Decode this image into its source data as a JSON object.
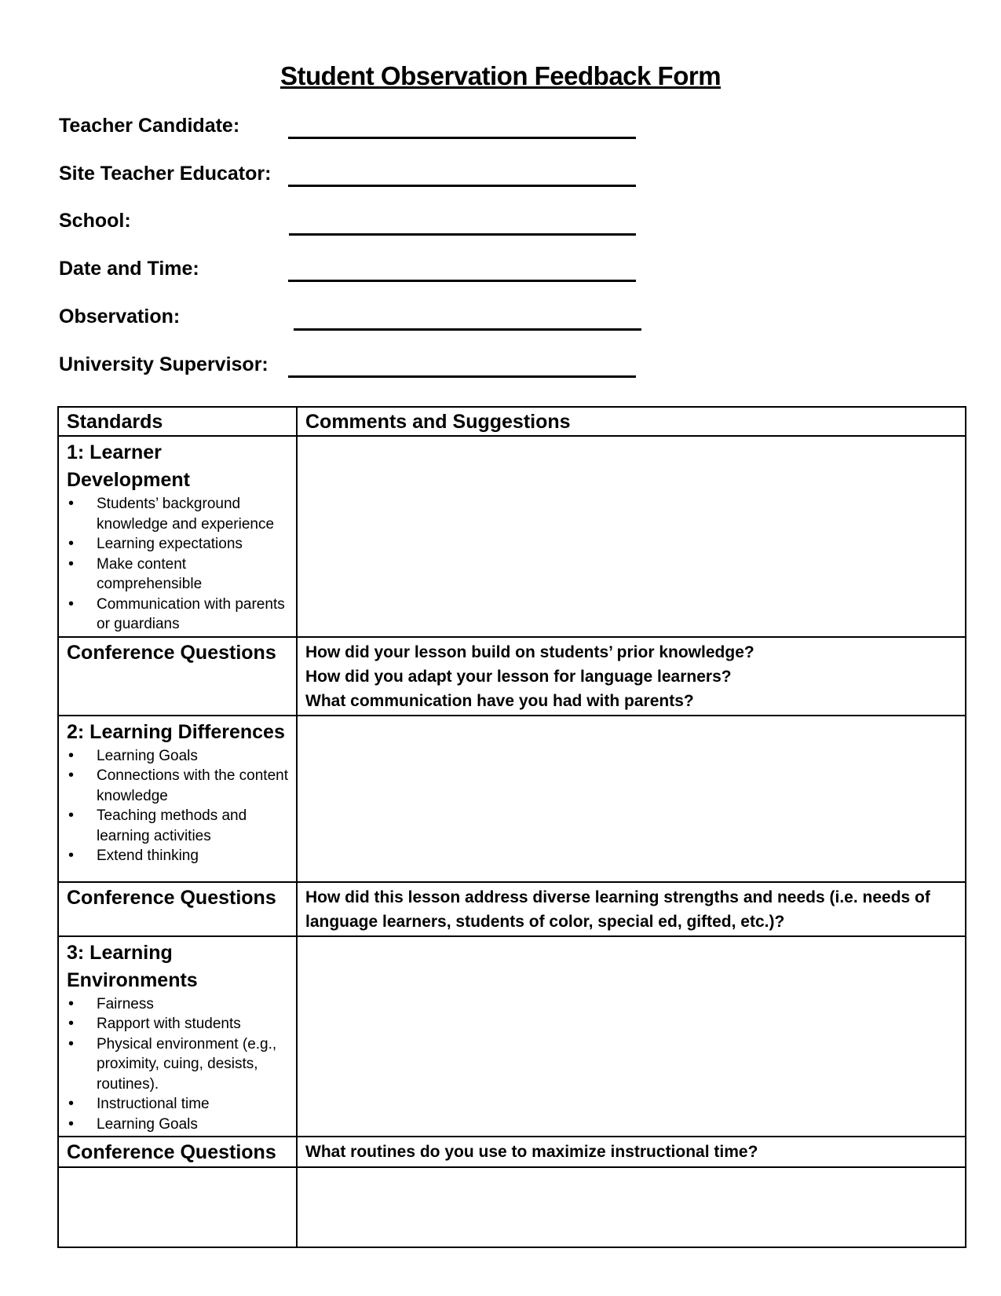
{
  "title": "Student Observation Feedback Form",
  "fields": [
    {
      "label": "Teacher Candidate:",
      "value": ""
    },
    {
      "label": "Site Teacher Educator:",
      "value": ""
    },
    {
      "label": "School:",
      "value": ""
    },
    {
      "label": "Date and Time:",
      "value": ""
    },
    {
      "label": "Observation:",
      "value": ""
    },
    {
      "label": "University Supervisor:",
      "value": ""
    }
  ],
  "table": {
    "headers": [
      "Standards",
      "Comments and Suggestions"
    ],
    "conference_label": "Conference Questions",
    "standards": [
      {
        "title": "1: Learner Development",
        "bullets": [
          "Students’ background knowledge and experience",
          "Learning expectations",
          "Make content comprehensible",
          "Communication with parents or guardians"
        ],
        "comments": "",
        "questions": [
          "How did your lesson build on students’ prior knowledge?",
          "How did you adapt your lesson for language learners?",
          "What communication have you had with parents?"
        ]
      },
      {
        "title": "2: Learning Differences",
        "bullets": [
          "Learning Goals",
          "Connections with the content knowledge",
          "Teaching methods and learning activities",
          "Extend thinking"
        ],
        "comments": "",
        "questions": [
          "How did this lesson address diverse learning strengths and needs (i.e. needs of language learners, students of color, special ed, gifted, etc.)?"
        ]
      },
      {
        "title": "3: Learning Environments",
        "bullets": [
          "Fairness",
          "Rapport with students",
          "Physical environment (e.g., proximity, cuing, desists, routines).",
          "Instructional time",
          "Learning Goals"
        ],
        "comments": "",
        "questions": [
          "What routines do you use to maximize instructional time?"
        ]
      }
    ],
    "last_row": {
      "left": "",
      "right": ""
    }
  }
}
